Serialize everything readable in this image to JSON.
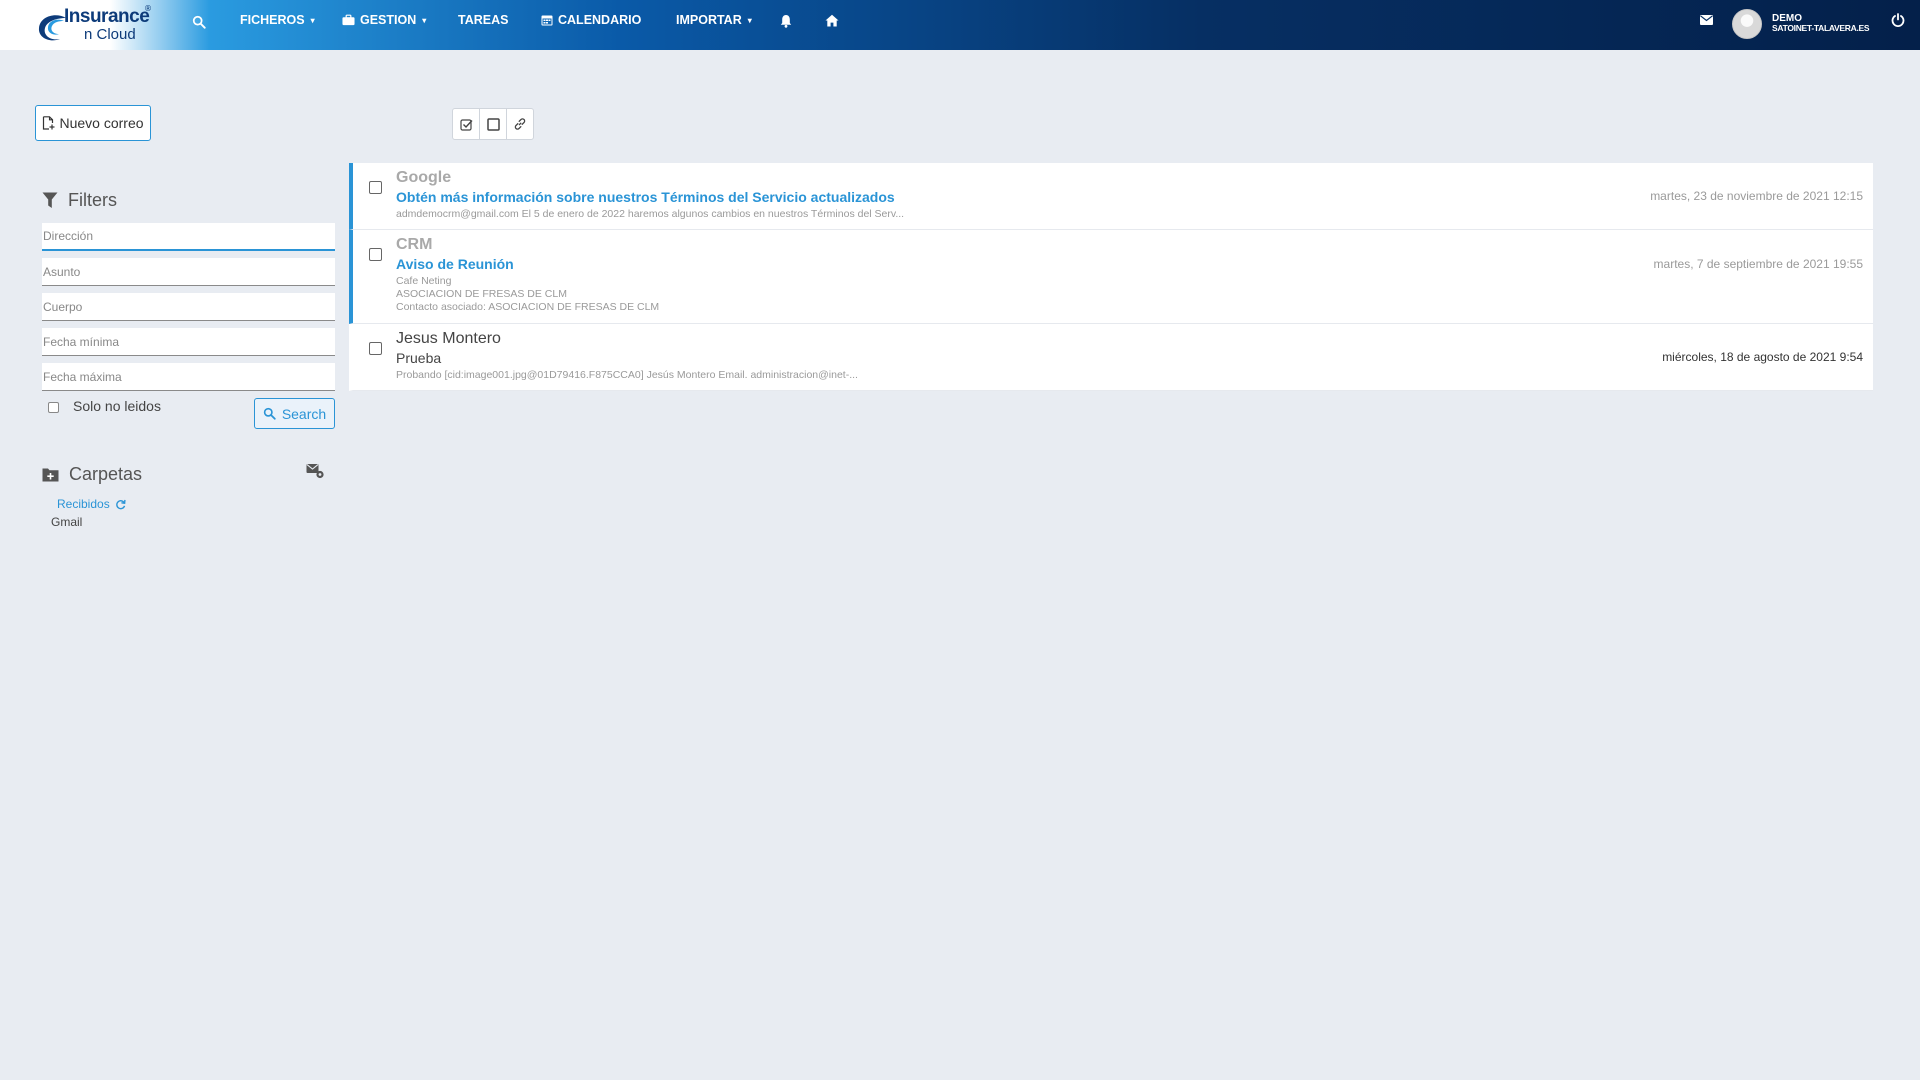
{
  "app": {
    "logo_line1": "Insurance",
    "logo_line2": "n Cloud",
    "logo_reg": "®"
  },
  "nav": {
    "search_icon": "search-icon",
    "items": [
      {
        "label": "FICHEROS",
        "has_caret": true
      },
      {
        "label": "GESTION",
        "has_caret": true,
        "icon": "briefcase-icon"
      },
      {
        "label": "TAREAS",
        "has_caret": false
      },
      {
        "label": "CALENDARIO",
        "has_caret": false,
        "icon": "calendar-icon"
      },
      {
        "label": "IMPORTAR",
        "has_caret": true
      }
    ],
    "caret": "▾"
  },
  "user": {
    "name": "DEMO",
    "domain": "SATOINET-TALAVERA.ES"
  },
  "compose": {
    "label": "Nuevo correo"
  },
  "filters": {
    "title": "Filters",
    "fields": [
      {
        "placeholder": "Dirección"
      },
      {
        "placeholder": "Asunto"
      },
      {
        "placeholder": "Cuerpo"
      },
      {
        "placeholder": "Fecha mínima"
      },
      {
        "placeholder": "Fecha máxima"
      }
    ],
    "unread_only_label": "Solo no leidos",
    "search_label": "Search"
  },
  "folders": {
    "title": "Carpetas",
    "items": [
      {
        "label": "Recibidos",
        "active": true
      },
      {
        "label": "Gmail",
        "active": false
      }
    ]
  },
  "mails": [
    {
      "from": "Google",
      "subject": "Obtén más información sobre nuestros Términos del Servicio actualizados",
      "snippet": [
        "admdemocrm@gmail.com El 5 de enero de 2022 haremos algunos cambios en nuestros Términos del Serv..."
      ],
      "date": "martes, 23 de noviembre de 2021 12:15",
      "unread": true
    },
    {
      "from": "CRM",
      "subject": "Aviso de Reunión",
      "snippet": [
        "Cafe Neting",
        "ASOCIACION DE FRESAS DE CLM",
        "Contacto asociado: ASOCIACION DE FRESAS DE CLM"
      ],
      "date": "martes, 7 de septiembre de 2021 19:55",
      "unread": true
    },
    {
      "from": "Jesus Montero",
      "subject": "Prueba",
      "snippet": [
        "Probando [cid:image001.jpg@01D79416.F875CCA0] Jesús Montero Email. administracion@inet-..."
      ],
      "date": "miércoles, 18 de agosto de 2021 9:54",
      "unread": false
    }
  ],
  "colors": {
    "accent": "#2a94d6",
    "read_text": "#333333",
    "unread_from": "#a9a9a9"
  }
}
